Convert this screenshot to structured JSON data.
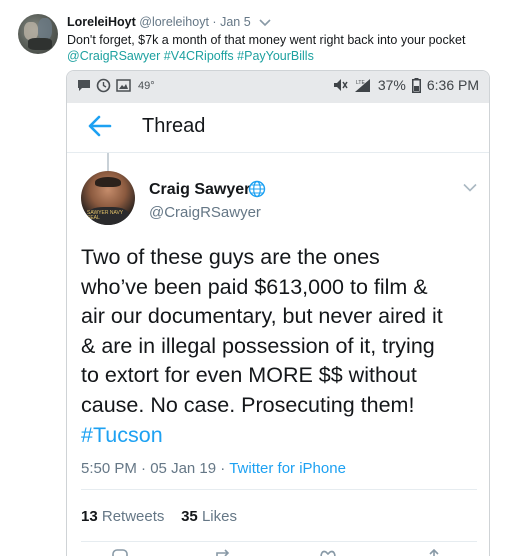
{
  "outer_tweet": {
    "name": "LoreleiHoyt",
    "handle": "@loreleihoyt",
    "separator": "·",
    "date": "Jan 5",
    "text": "Don't forget, $7k a month of that money went right back into your pocket",
    "hashtags_line": "@CraigRSawyer #V4CRipoffs #PayYourBills"
  },
  "status_bar": {
    "temperature": "49°",
    "battery": "37%",
    "time": "6:36 PM"
  },
  "thread_header": {
    "title": "Thread"
  },
  "tweet": {
    "author_name": "Craig Sawyer",
    "author_handle": "@CraigRSawyer",
    "avatar_text": "SAWYER\nNAVY SEAL",
    "body_lines": [
      "Two of these guys are the ones",
      "who’ve been paid $613,000 to film &",
      "air our documentary, but never aired it",
      "& are in illegal possession of it, trying",
      "to extort for even MORE $$ without",
      "cause. No case. Prosecuting them!"
    ],
    "hashtag": "#Tucson",
    "time": "5:50 PM",
    "meta_sep": "·",
    "date": "05 Jan 19",
    "source": "Twitter for iPhone",
    "retweets_count": "13",
    "retweets_label": "Retweets",
    "likes_count": "35",
    "likes_label": "Likes"
  },
  "colors": {
    "link_blue": "#1da1f2",
    "hashtag_teal": "#1da1a0",
    "muted_gray": "#657786"
  },
  "icons": [
    "chevron-down-icon",
    "message-icon",
    "timer-icon",
    "image-icon",
    "mute-icon",
    "signal-icon",
    "battery-icon",
    "back-arrow-icon",
    "globe-icon",
    "reply-icon",
    "retweet-icon",
    "like-icon",
    "share-icon"
  ]
}
